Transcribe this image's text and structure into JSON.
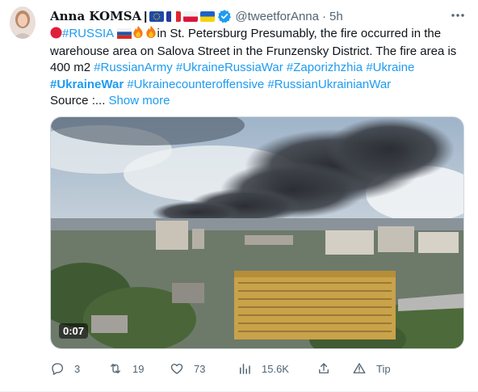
{
  "tweet": {
    "author_name": "Anna KOMSA",
    "name_separator": "|",
    "handle": "@tweetforAnna",
    "dot": "·",
    "time": "5h",
    "text": {
      "line1_tag": "#RUSSIA",
      "line1_rest": "in St. Petersburg Presumably, the fire occurred in the warehouse area on Salova Street in the Frunzensky District. The fire area is 400 m2",
      "tags": [
        "#RussianArmy",
        "#UkraineRussiaWar",
        "#Zaporizhzhia",
        "#Ukraine"
      ],
      "bold_tag": "#UkraineWar",
      "tags2": [
        "#Ukrainecounteroffensive",
        "#RussianUkrainianWar"
      ],
      "source": "Source :...",
      "show_more": "Show more"
    },
    "video_duration": "0:07",
    "actions": {
      "replies": "3",
      "retweets": "19",
      "likes": "73",
      "views": "15.6K",
      "tip": "Tip"
    }
  },
  "icons": {
    "avatar": "avatar",
    "verified": "verified-badge-icon",
    "more": "more-options-icon",
    "reply": "reply-icon",
    "retweet": "retweet-icon",
    "like": "heart-icon",
    "views": "views-icon",
    "share": "share-icon",
    "tip": "tip-icon"
  },
  "colors": {
    "link": "#1d9bf0",
    "muted": "#536471",
    "text": "#0f1419"
  }
}
